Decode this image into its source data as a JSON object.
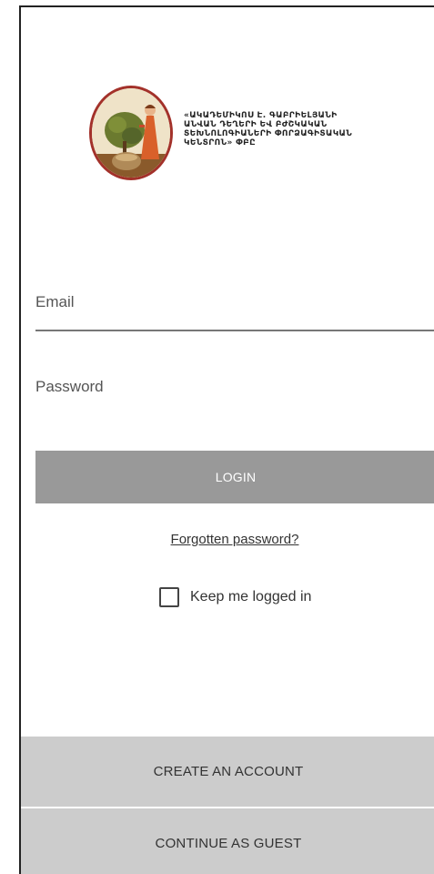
{
  "logo": {
    "lines": [
      "«ԱԿԱԴԵՄԻԿՈՍ Է. ԳԱԲՐԻԵԼՅԱՆԻ",
      "ԱՆՎԱՆ ԴԵՂԵՐԻ ԵՎ ԲԺՇԿԱԿԱՆ",
      "ՏԵԽՆՈԼՈԳԻԱՆԵՐԻ ՓՈՐՁԱԳԻՏԱԿԱՆ",
      "ԿԵՆՏՐՈՆ» ՓԲԸ"
    ],
    "colors": {
      "ring": "#a3312a",
      "figure": "#d9602a",
      "tree": "#6b7a2f",
      "ground": "#8a5a2b"
    }
  },
  "form": {
    "email_label": "Email",
    "password_label": "Password",
    "login_label": "LOGIN",
    "forgot_label": "Forgotten password?",
    "keep_logged_in_label": "Keep me logged in",
    "keep_logged_in_checked": false
  },
  "footer": {
    "create_account_label": "CREATE AN ACCOUNT",
    "guest_label": "CONTINUE AS GUEST"
  },
  "colors": {
    "login_button": "#999999",
    "bottom_buttons": "#cccccc",
    "background": "#ffffff"
  }
}
